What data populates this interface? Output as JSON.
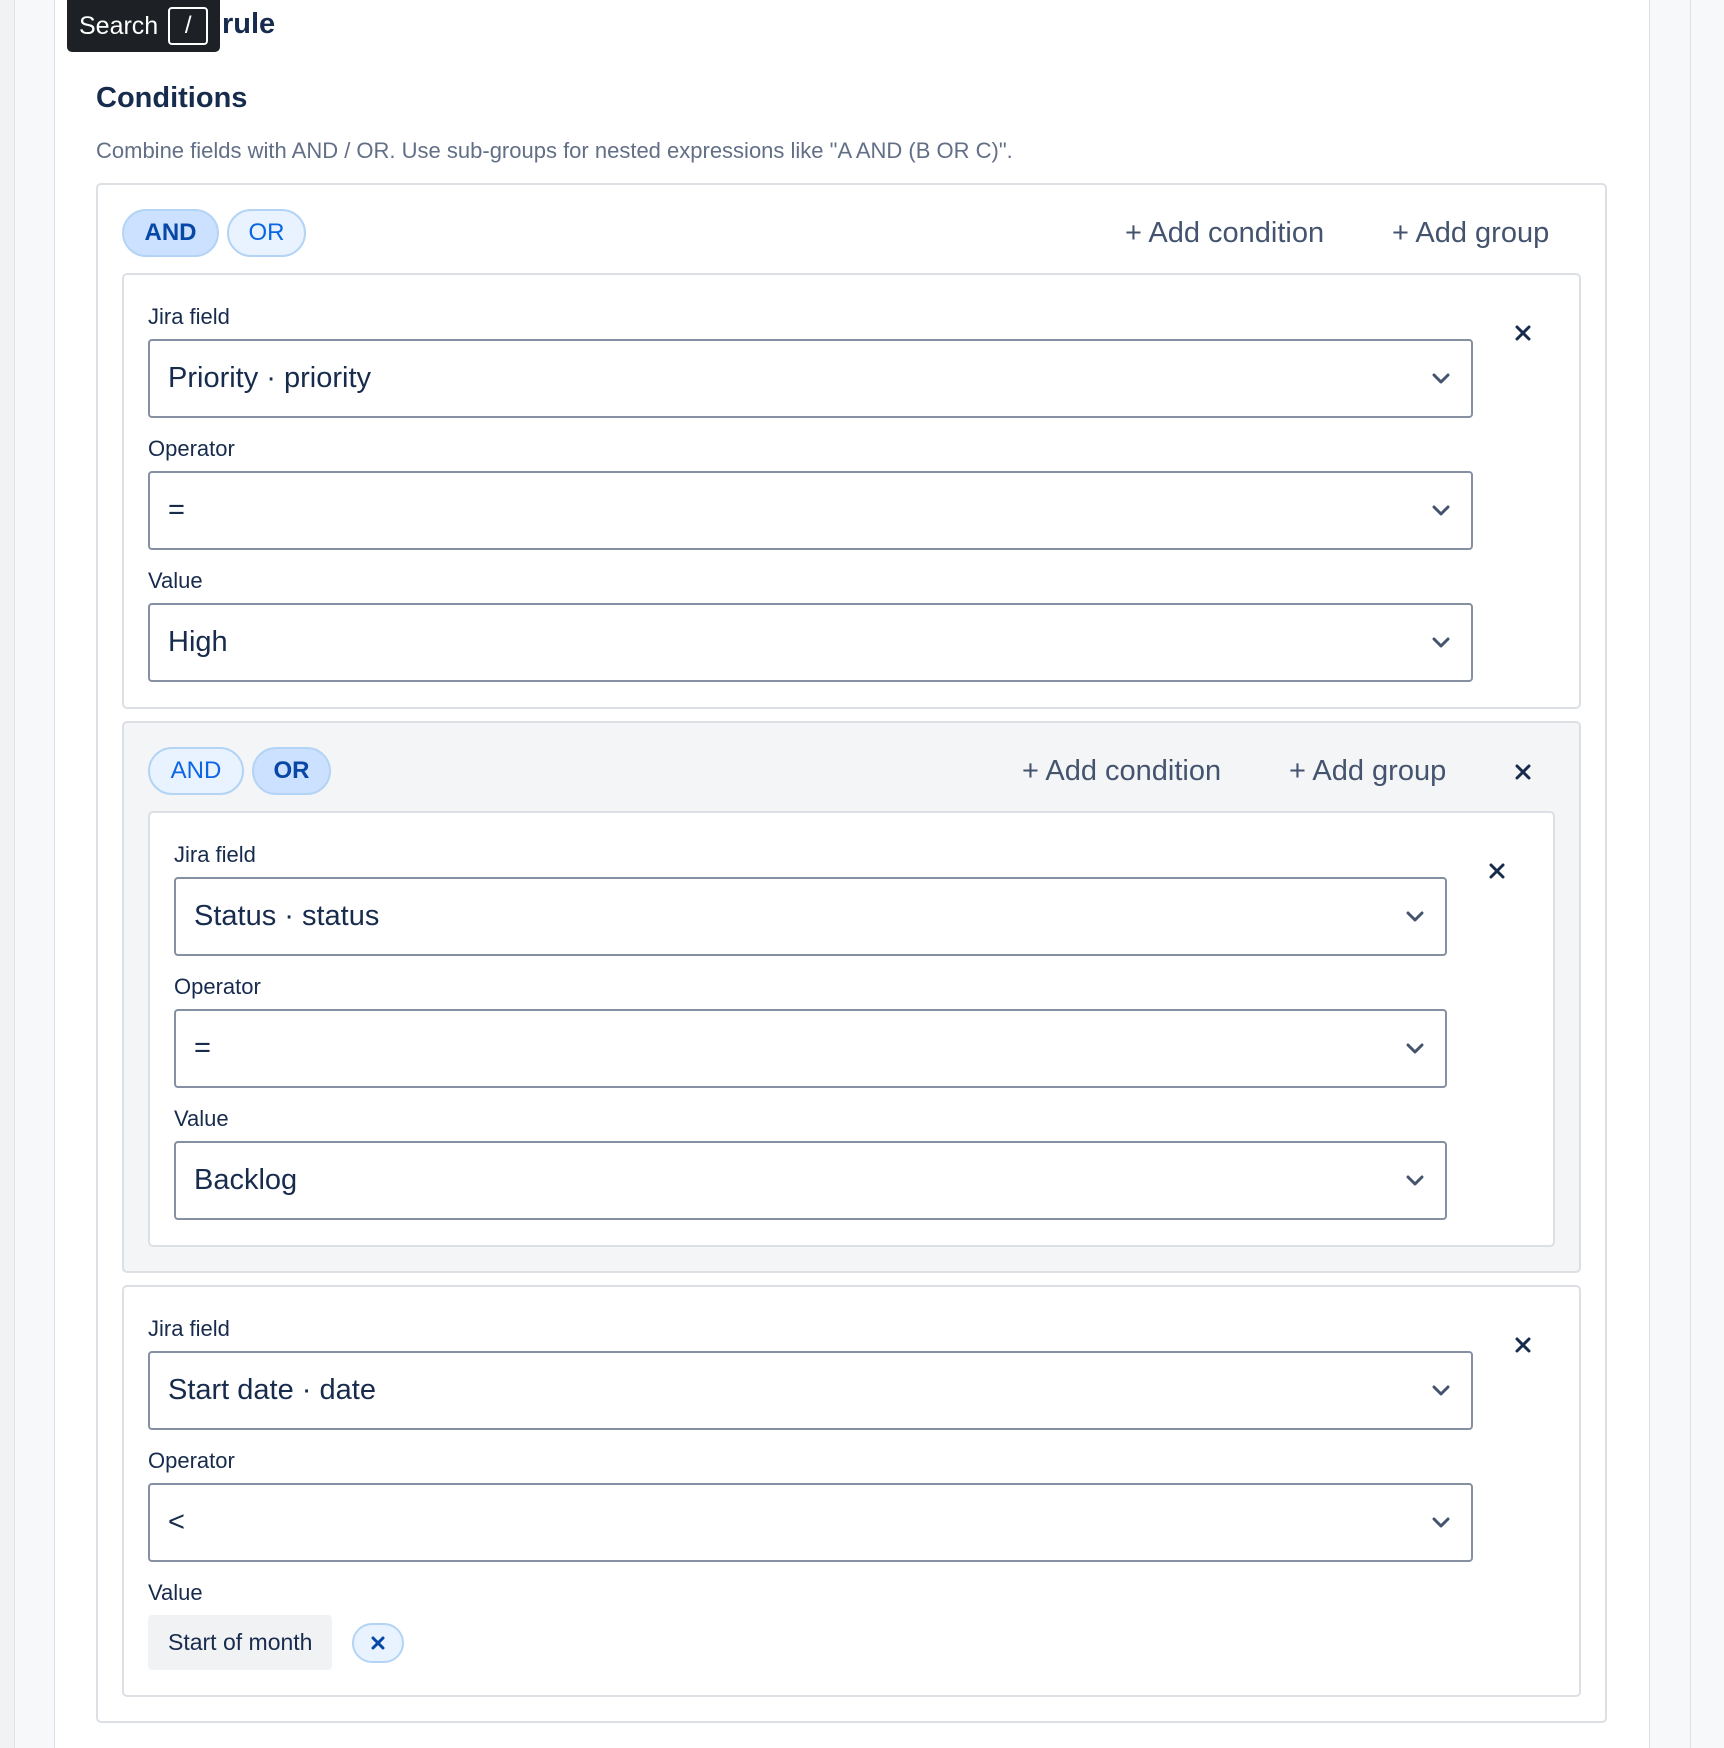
{
  "tooltip": {
    "label": "Search",
    "shortcut": "/"
  },
  "rule_title": "rule",
  "conditions": {
    "title": "Conditions",
    "description": "Combine fields with AND / OR. Use sub-groups for nested expressions like \"A AND (B OR C)\"."
  },
  "root_group": {
    "and_label": "AND",
    "or_label": "OR",
    "selected_operator": "AND",
    "add_condition": "+ Add condition",
    "add_group": "+ Add group",
    "condition1": {
      "field_label": "Jira field",
      "field_value": "Priority · priority",
      "operator_label": "Operator",
      "operator_value": "=",
      "value_label": "Value",
      "value_value": "High"
    },
    "subgroup": {
      "and_label": "AND",
      "or_label": "OR",
      "selected_operator": "OR",
      "add_condition": "+ Add condition",
      "add_group": "+ Add group",
      "condition": {
        "field_label": "Jira field",
        "field_value": "Status · status",
        "operator_label": "Operator",
        "operator_value": "=",
        "value_label": "Value",
        "value_value": "Backlog"
      }
    },
    "condition3": {
      "field_label": "Jira field",
      "field_value": "Start date · date",
      "operator_label": "Operator",
      "operator_value": "<",
      "value_label": "Value",
      "value_chip": "Start of month"
    }
  },
  "icons": {
    "close": "close-icon",
    "chevron": "chevron-down-icon"
  },
  "colors": {
    "accent": "#0c66e4",
    "pill_bg": "#e9f2ff",
    "tooltip_bg": "#1d2125",
    "border": "#8590a2"
  }
}
